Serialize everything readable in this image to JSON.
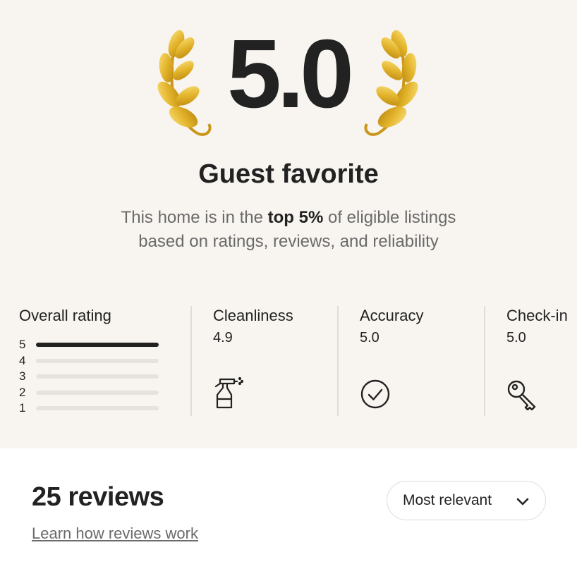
{
  "hero": {
    "score": "5.0",
    "title": "Guest favorite",
    "subtitle_before": "This home is in the ",
    "subtitle_bold": "top 5%",
    "subtitle_after": " of eligible listings",
    "subtitle_line2": "based on ratings, reviews, and reliability",
    "laurel_color": "#d9a71a"
  },
  "overall": {
    "label": "Overall rating",
    "bars": [
      {
        "stars": "5",
        "fraction": 1.0
      },
      {
        "stars": "4",
        "fraction": 0
      },
      {
        "stars": "3",
        "fraction": 0
      },
      {
        "stars": "2",
        "fraction": 0
      },
      {
        "stars": "1",
        "fraction": 0
      }
    ]
  },
  "categories": [
    {
      "label": "Cleanliness",
      "value": "4.9",
      "icon": "spray-bottle-icon"
    },
    {
      "label": "Accuracy",
      "value": "5.0",
      "icon": "check-circle-icon"
    },
    {
      "label": "Check-in",
      "value": "5.0",
      "icon": "key-icon"
    }
  ],
  "reviews": {
    "count_label": "25 reviews",
    "learn_link": "Learn how reviews work",
    "sort_label": "Most relevant",
    "sort_icon": "chevron-down-icon"
  },
  "colors": {
    "hero_bg": "#f8f5f0",
    "text": "#222222",
    "muted": "#6a6a6a"
  }
}
